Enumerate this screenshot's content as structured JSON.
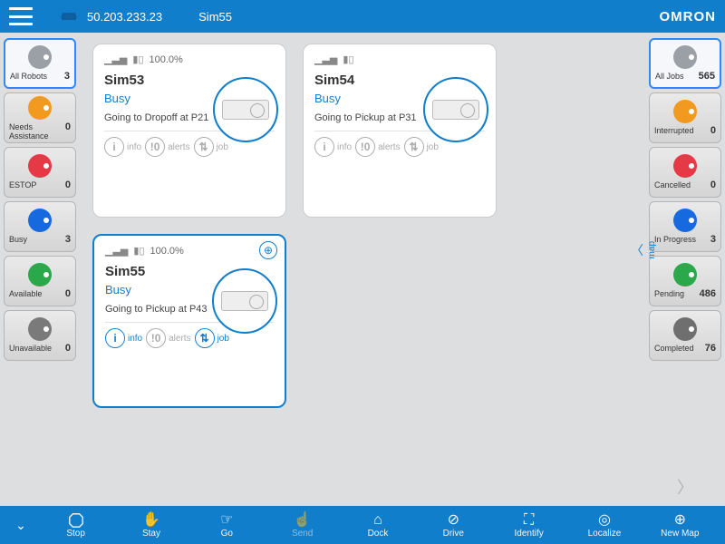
{
  "header": {
    "ip": "50.203.233.23",
    "sim_name": "Sim55",
    "brand": "OMRON"
  },
  "left_rail": [
    {
      "id": "all",
      "label": "All Robots",
      "count": 3,
      "color": "#9aa0a6",
      "selected": true
    },
    {
      "id": "na",
      "label": "Needs Assistance",
      "count": 0,
      "color": "#f29a1f"
    },
    {
      "id": "estop",
      "label": "ESTOP",
      "count": 0,
      "color": "#e63946"
    },
    {
      "id": "busy",
      "label": "Busy",
      "count": 3,
      "color": "#1769e0"
    },
    {
      "id": "avail",
      "label": "Available",
      "count": 0,
      "color": "#2aa84a"
    },
    {
      "id": "unav",
      "label": "Unavailable",
      "count": 0,
      "color": "#7a7a7a"
    }
  ],
  "right_rail": [
    {
      "id": "alljobs",
      "label": "All Jobs",
      "count": 565,
      "color": "#9aa0a6",
      "selected": true
    },
    {
      "id": "interrupted",
      "label": "Interrupted",
      "count": 0,
      "color": "#f29a1f"
    },
    {
      "id": "cancelled",
      "label": "Cancelled",
      "count": 0,
      "color": "#e63946"
    },
    {
      "id": "inprogress",
      "label": "In Progress",
      "count": 3,
      "color": "#1769e0"
    },
    {
      "id": "pending",
      "label": "Pending",
      "count": 486,
      "color": "#2aa84a"
    },
    {
      "id": "completed",
      "label": "Completed",
      "count": 76,
      "color": "#6f6f6f"
    }
  ],
  "map_handle": "map",
  "cards": [
    {
      "id": "sim53",
      "name": "Sim53",
      "state": "Busy",
      "battery": "100.0%",
      "msg": "Going to Dropoff at P21",
      "selected": false,
      "actions": [
        {
          "key": "info",
          "label": "info",
          "active": false
        },
        {
          "key": "alerts",
          "label": "alerts",
          "active": false,
          "badge": "0"
        },
        {
          "key": "job",
          "label": "job",
          "active": false
        }
      ]
    },
    {
      "id": "sim54",
      "name": "Sim54",
      "state": "Busy",
      "battery": "",
      "msg": "Going to Pickup at P31",
      "selected": false,
      "actions": [
        {
          "key": "info",
          "label": "info",
          "active": false
        },
        {
          "key": "alerts",
          "label": "alerts",
          "active": false,
          "badge": "0"
        },
        {
          "key": "job",
          "label": "job",
          "active": false
        }
      ]
    },
    {
      "id": "sim55",
      "name": "Sim55",
      "state": "Busy",
      "battery": "100.0%",
      "msg": "Going to Pickup at P43",
      "selected": true,
      "globe": true,
      "actions": [
        {
          "key": "info",
          "label": "info",
          "active": true
        },
        {
          "key": "alerts",
          "label": "alerts",
          "active": false,
          "badge": "0"
        },
        {
          "key": "job",
          "label": "job",
          "active": true
        }
      ]
    }
  ],
  "footer": [
    {
      "id": "stop",
      "label": "Stop"
    },
    {
      "id": "stay",
      "label": "Stay"
    },
    {
      "id": "go",
      "label": "Go"
    },
    {
      "id": "send",
      "label": "Send",
      "dim": true
    },
    {
      "id": "dock",
      "label": "Dock"
    },
    {
      "id": "drive",
      "label": "Drive"
    },
    {
      "id": "identify",
      "label": "Identify"
    },
    {
      "id": "localize",
      "label": "Localize"
    },
    {
      "id": "newmap",
      "label": "New Map"
    }
  ]
}
